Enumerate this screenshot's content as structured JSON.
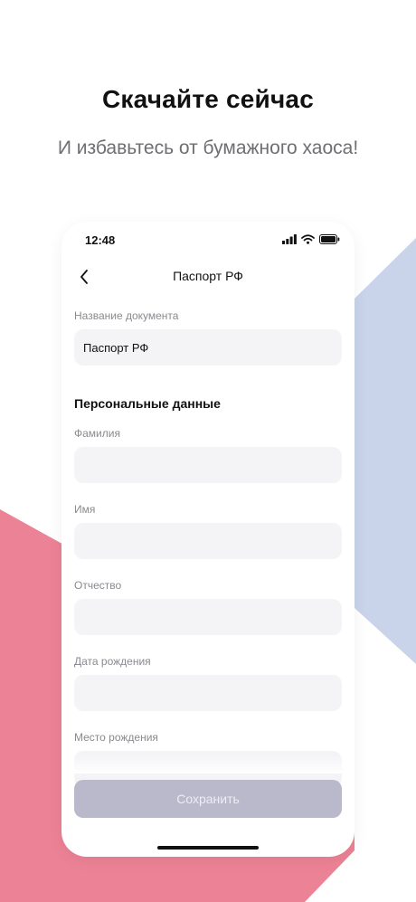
{
  "promo": {
    "title": "Скачайте сейчас",
    "subtitle": "И избавьтесь от бумажного хаоса!"
  },
  "colors": {
    "pink_shape": "#ec8295",
    "blue_shape": "#c9d3ea",
    "field_bg": "#f4f4f7",
    "button_disabled": "#b9b9cb"
  },
  "status_bar": {
    "time": "12:48",
    "icons": [
      "signal-icon",
      "wifi-icon",
      "battery-icon"
    ]
  },
  "nav": {
    "back_icon": "chevron-left-icon",
    "title": "Паспорт РФ"
  },
  "form": {
    "doc_name_label": "Название документа",
    "doc_name_value": "Паспорт РФ",
    "section_title": "Персональные данные",
    "fields": [
      {
        "label": "Фамилия",
        "value": ""
      },
      {
        "label": "Имя",
        "value": ""
      },
      {
        "label": "Отчество",
        "value": ""
      },
      {
        "label": "Дата рождения",
        "value": ""
      },
      {
        "label": "Место рождения",
        "value": ""
      }
    ],
    "save_label": "Сохранить"
  }
}
